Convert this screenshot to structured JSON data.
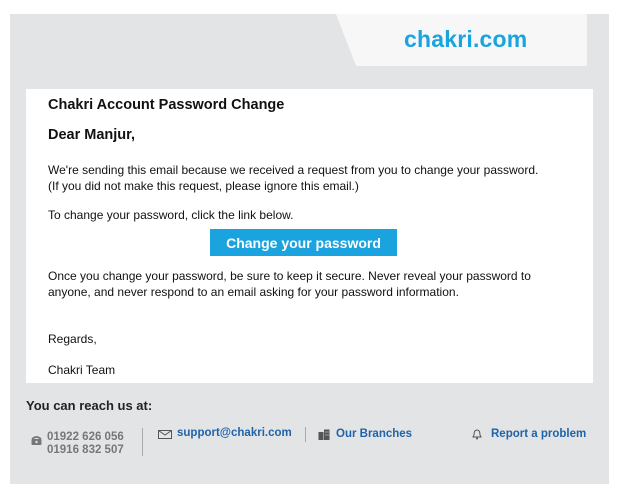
{
  "brand": {
    "logo": "chakri.com",
    "accent_color": "#1aa3df",
    "link_color": "#1f63a8"
  },
  "email": {
    "title": "Chakri Account Password Change",
    "greeting": "Dear Manjur,",
    "para1_line1": "We're sending this email because we received a request from you to change your password.",
    "para1_line2": "(If you did not make this request, please ignore this email.)",
    "para2": "To change your password, click the link below.",
    "cta_label": "Change your password",
    "para3_line1": "Once you change your password, be sure to keep it secure. Never reveal your password to",
    "para3_line2": "anyone, and never respond to an email asking for your password information.",
    "regards": "Regards,",
    "signature": "Chakri Team"
  },
  "footer": {
    "reach_label": "You can reach us at:",
    "phone1": "01922 626 056",
    "phone2": "01916 832 507",
    "email_link": "support@chakri.com",
    "branches_link": "Our Branches",
    "report_link": "Report a problem",
    "icons": [
      "phone-icon",
      "mail-icon",
      "building-icon",
      "bell-icon"
    ]
  }
}
